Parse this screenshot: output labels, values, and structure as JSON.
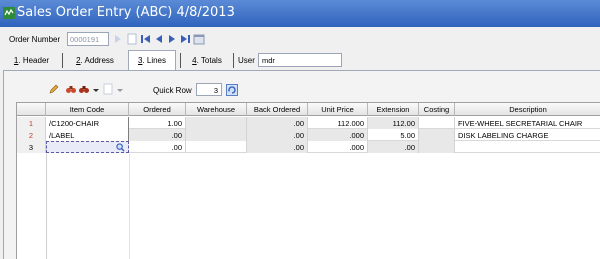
{
  "window": {
    "title": "Sales Order Entry (ABC) 4/8/2013"
  },
  "order": {
    "label": "Order Number",
    "value": "0000191"
  },
  "tabs": [
    {
      "label": "1. Header",
      "mnemonic": "1"
    },
    {
      "label": "2. Address",
      "mnemonic": "2"
    },
    {
      "label": "3. Lines",
      "mnemonic": "3"
    },
    {
      "label": "4. Totals",
      "mnemonic": "4"
    }
  ],
  "user": {
    "label": "User",
    "value": "mdr"
  },
  "lines_toolbar": {
    "quick_row_label": "Quick Row",
    "quick_row_value": "3"
  },
  "grid": {
    "columns": [
      "",
      "Item Code",
      "Ordered",
      "Warehouse",
      "Back Ordered",
      "Unit Price",
      "Extension",
      "Costing",
      "Description"
    ],
    "rows": [
      {
        "num": "1",
        "item": "/C1200-CHAIR",
        "ordered": "1.00",
        "warehouse": "",
        "back_ordered": ".00",
        "unit_price": "112.000",
        "extension": "112.00",
        "costing": "",
        "description": "FIVE-WHEEL SECRETARIAL CHAIR"
      },
      {
        "num": "2",
        "item": "/LABEL",
        "ordered": ".00",
        "warehouse": "",
        "back_ordered": ".00",
        "unit_price": ".000",
        "extension": "5.00",
        "costing": "",
        "description": "DISK LABELING CHARGE"
      },
      {
        "num": "3",
        "item": "",
        "ordered": ".00",
        "warehouse": "",
        "back_ordered": ".00",
        "unit_price": ".000",
        "extension": ".00",
        "costing": "",
        "description": ""
      }
    ]
  },
  "colors": {
    "title_bar": "#2f63bd",
    "row_number": "#c0392b"
  }
}
